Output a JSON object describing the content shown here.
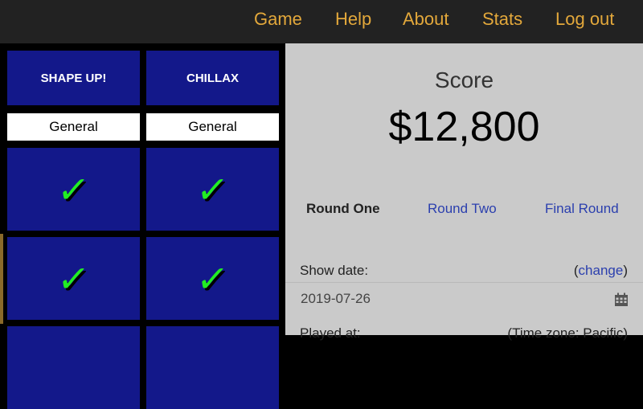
{
  "nav": {
    "items": [
      "Game",
      "Help",
      "About",
      "Stats",
      "Log out"
    ]
  },
  "board": {
    "categories": [
      {
        "title": "SHAPE UP!",
        "type": "General"
      },
      {
        "title": "CHILLAX",
        "type": "General"
      }
    ],
    "check_glyph": "✓"
  },
  "score": {
    "label": "Score",
    "value": "$12,800"
  },
  "rounds": {
    "tabs": [
      "Round One",
      "Round Two",
      "Final Round"
    ],
    "active": "Round One"
  },
  "show_date": {
    "label": "Show date:",
    "change_open": "(",
    "change_link": "change",
    "change_close": ")",
    "value": "2019-07-26"
  },
  "played_at": {
    "label": "Played at:",
    "timezone": "(Time zone: Pacific)"
  },
  "colors": {
    "nav_bg": "#222222",
    "nav_link": "#e3a83b",
    "cell_blue": "#13188a",
    "check_green": "#22ee22",
    "panel_bg": "#cacaca",
    "link_blue": "#2b3fae"
  },
  "icons": {
    "calendar": "calendar-icon",
    "check": "check-icon"
  }
}
